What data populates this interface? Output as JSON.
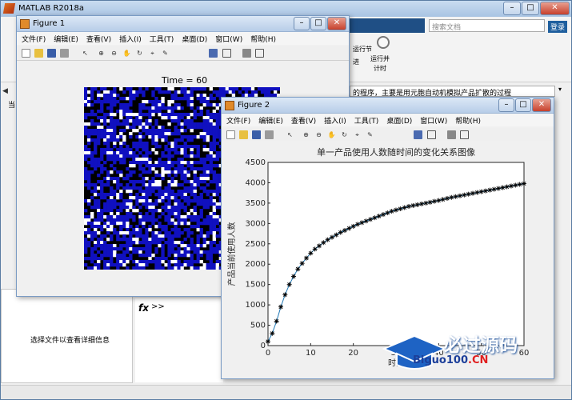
{
  "main_window": {
    "title": "MATLAB R2018a",
    "search_placeholder": "搜索文档",
    "login_label": "登录",
    "ribbon_labels": [
      "运行节",
      "进",
      "运行并\n计时"
    ],
    "current_path_text": "的程序，主要是用元胞自动机模拟产品扩散的过程",
    "command_prompt": ">>",
    "fx_label": "fx",
    "detail_text": "选择文件以查看详细信息",
    "left_stub_1": "当",
    "left_stub_2": "详"
  },
  "figure1": {
    "title": "Figure 1",
    "menu": [
      "文件(F)",
      "编辑(E)",
      "查看(V)",
      "插入(I)",
      "工具(T)",
      "桌面(D)",
      "窗口(W)",
      "帮助(H)"
    ],
    "heading": "Time = 60",
    "grid_colors": {
      "filled": "#1010c0",
      "empty": "#000000",
      "new": "#ffffff"
    }
  },
  "figure2": {
    "title": "Figure 2",
    "menu": [
      "文件(F)",
      "编辑(E)",
      "查看(V)",
      "插入(I)",
      "工具(T)",
      "桌面(D)",
      "窗口(W)",
      "帮助(H)"
    ]
  },
  "chart_data": {
    "type": "line",
    "title": "单一产品使用人数随时间的变化关系图像",
    "xlabel": "时间",
    "ylabel": "产品当前使用人数",
    "xlim": [
      0,
      60
    ],
    "ylim": [
      0,
      4500
    ],
    "xticks": [
      0,
      10,
      20,
      30,
      40,
      50,
      60
    ],
    "yticks": [
      0,
      500,
      1000,
      1500,
      2000,
      2500,
      3000,
      3500,
      4000,
      4500
    ],
    "grid": false,
    "line_color": "#1f77b4",
    "marker": "asterisk",
    "x": [
      0,
      1,
      2,
      3,
      4,
      5,
      6,
      7,
      8,
      9,
      10,
      11,
      12,
      13,
      14,
      15,
      16,
      17,
      18,
      19,
      20,
      21,
      22,
      23,
      24,
      25,
      26,
      27,
      28,
      29,
      30,
      31,
      32,
      33,
      34,
      35,
      36,
      37,
      38,
      39,
      40,
      41,
      42,
      43,
      44,
      45,
      46,
      47,
      48,
      49,
      50,
      51,
      52,
      53,
      54,
      55,
      56,
      57,
      58,
      59,
      60
    ],
    "y": [
      100,
      300,
      600,
      950,
      1250,
      1500,
      1700,
      1880,
      2020,
      2150,
      2270,
      2370,
      2450,
      2530,
      2600,
      2660,
      2720,
      2780,
      2830,
      2880,
      2930,
      2980,
      3020,
      3060,
      3100,
      3140,
      3180,
      3220,
      3260,
      3300,
      3330,
      3360,
      3390,
      3420,
      3440,
      3460,
      3480,
      3500,
      3520,
      3545,
      3565,
      3590,
      3615,
      3640,
      3660,
      3680,
      3700,
      3720,
      3740,
      3760,
      3780,
      3800,
      3820,
      3840,
      3860,
      3880,
      3900,
      3920,
      3940,
      3960,
      3980
    ]
  },
  "watermark": {
    "brand": "必过源码",
    "url_main": "Biguo100",
    "url_suffix": ".CN"
  }
}
